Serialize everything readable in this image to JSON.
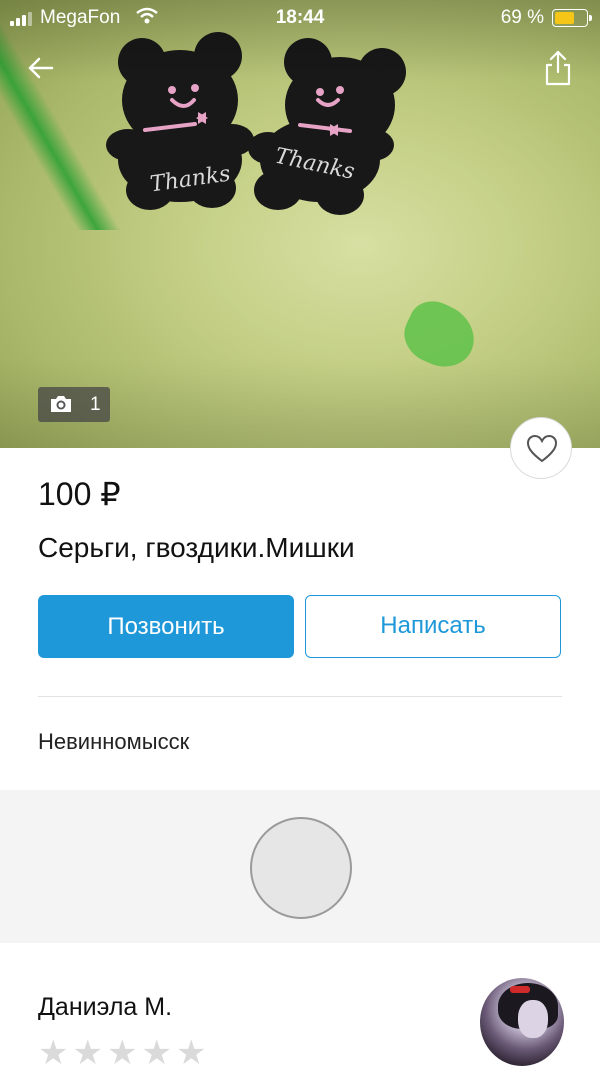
{
  "status_bar": {
    "carrier": "MegaFon",
    "time": "18:44",
    "battery_text": "69 %",
    "battery_level": 0.69,
    "battery_color": "#f5c518"
  },
  "hero": {
    "photo_count": "1",
    "icons": {
      "back": "back-arrow-icon",
      "share": "share-icon",
      "camera": "camera-icon",
      "favorite": "heart-icon"
    }
  },
  "listing": {
    "price": "100 ₽",
    "title": "Серьги, гвоздики.Мишки",
    "call_label": "Позвонить",
    "write_label": "Написать",
    "city": "Невинномысск"
  },
  "seller": {
    "name": "Даниэла М.",
    "rating_stars": 5,
    "rating_filled": 0
  },
  "colors": {
    "accent": "#1e98d9",
    "star_empty": "#dadada"
  }
}
